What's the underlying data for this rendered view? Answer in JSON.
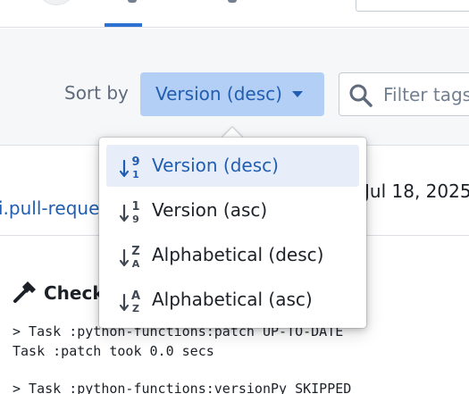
{
  "toolbar": {
    "sort_label": "Sort by",
    "sort_value": "Version (desc)",
    "filter_placeholder": "Filter tags"
  },
  "sort_menu": {
    "items": [
      {
        "label": "Version (desc)",
        "icon": "sort-numeric-desc-icon",
        "top_glyph": "9",
        "bottom_glyph": "1",
        "active": true
      },
      {
        "label": "Version (asc)",
        "icon": "sort-numeric-asc-icon",
        "top_glyph": "1",
        "bottom_glyph": "9",
        "active": false
      },
      {
        "label": "Alphabetical (desc)",
        "icon": "sort-alphabetical-desc-icon",
        "top_glyph": "Z",
        "bottom_glyph": "A",
        "active": false
      },
      {
        "label": "Alphabetical (asc)",
        "icon": "sort-alphabetical-asc-icon",
        "top_glyph": "A",
        "bottom_glyph": "Z",
        "active": false
      }
    ]
  },
  "row": {
    "link": "i.pull-reque",
    "date": "Jul 18, 2025,"
  },
  "checks": {
    "title": "Checks",
    "icon": "hammer-icon",
    "log": [
      "> Task :python-functions:patch UP-TO-DATE",
      "Task :patch took 0.0 secs",
      "> Task :python-functions:versionPy SKIPPED"
    ]
  },
  "colors": {
    "accent": "#2d72d2",
    "accent_text": "#215db0",
    "button_bg": "#b3cff5",
    "active_item_bg": "#e7eefa",
    "toolbar_bg": "#f6f7f9"
  }
}
